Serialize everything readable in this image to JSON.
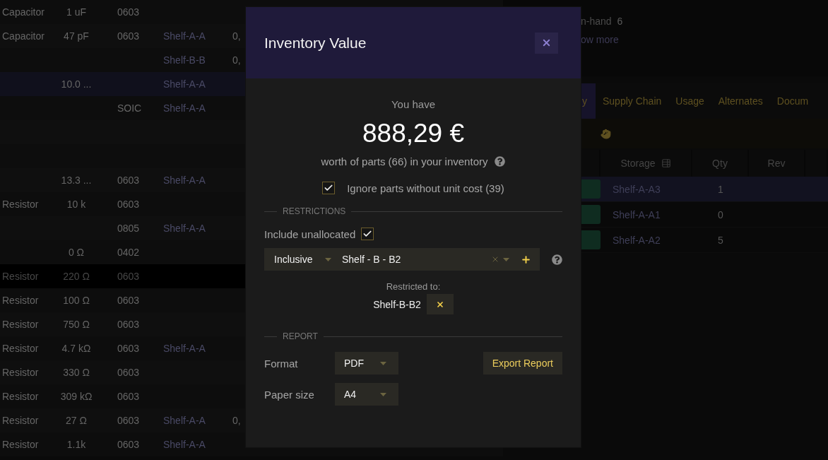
{
  "parts_table": {
    "rows": [
      {
        "column_1": "Capacitor",
        "column_2": "1 uF",
        "column_3": "0603",
        "selected": false,
        "disabled": false
      },
      {
        "column_1": "Capacitor",
        "column_2": "47 pF",
        "column_3": "0603",
        "column_4": "Shelf-A-A",
        "column_5": "0,",
        "selected": false,
        "disabled": false
      },
      {
        "column_4": "Shelf-B-B",
        "column_5": "0,",
        "selected": false,
        "disabled": false
      },
      {
        "column_2": "10.0 ...",
        "column_4": "Shelf-A-A",
        "selected": true,
        "disabled": false
      },
      {
        "column_3": "SOIC",
        "column_4": "Shelf-A-A",
        "selected": false,
        "disabled": false
      },
      {
        "selected": false,
        "disabled": false
      },
      {
        "selected": false,
        "disabled": false
      },
      {
        "column_2": "13.3 ...",
        "column_3": "0603",
        "column_4": "Shelf-A-A",
        "selected": false,
        "disabled": false
      },
      {
        "column_1": "Resistor",
        "column_2": "10 k",
        "column_3": "0603",
        "selected": false,
        "disabled": false
      },
      {
        "column_3": "0805",
        "column_4": "Shelf-A-A",
        "selected": false,
        "disabled": false
      },
      {
        "column_2": "0 Ω",
        "column_3": "0402",
        "selected": false,
        "disabled": false
      },
      {
        "column_1": "Resistor",
        "column_2": "220 Ω",
        "column_3": "0603",
        "selected": false,
        "disabled": true
      },
      {
        "column_1": "Resistor",
        "column_2": "100 Ω",
        "column_3": "0603",
        "selected": false,
        "disabled": false
      },
      {
        "column_1": "Resistor",
        "column_2": "750 Ω",
        "column_3": "0603",
        "selected": false,
        "disabled": false
      },
      {
        "column_1": "Resistor",
        "column_2": "4.7 kΩ",
        "column_3": "0603",
        "column_4": "Shelf-A-A",
        "selected": false,
        "disabled": false
      },
      {
        "column_1": "Resistor",
        "column_2": "330 Ω",
        "column_3": "0603",
        "selected": false,
        "disabled": false
      },
      {
        "column_1": "Resistor",
        "column_2": "309 kΩ",
        "column_3": "0603",
        "selected": false,
        "disabled": false
      },
      {
        "column_1": "Resistor",
        "column_2": "27 Ω",
        "column_3": "0603",
        "column_4": "Shelf-A-A",
        "column_5": "0,",
        "selected": false,
        "disabled": false
      },
      {
        "column_1": "Resistor",
        "column_2": "1.1k",
        "column_3": "0603",
        "column_4": "Shelf-A-A",
        "selected": false,
        "disabled": false
      }
    ]
  },
  "part_details": {
    "on_hand_label": "n-hand",
    "on_hand_value": "6",
    "show_more": "ow more"
  },
  "detail_tabs": [
    {
      "label": "y",
      "selected": true
    },
    {
      "label": "Supply Chain",
      "selected": false
    },
    {
      "label": "Usage",
      "selected": false
    },
    {
      "label": "Alternates",
      "selected": false
    },
    {
      "label": "Docum",
      "selected": false
    }
  ],
  "storage_table": {
    "columns": [
      "Storage",
      "Qty",
      "Rev"
    ],
    "rows": [
      {
        "storage": "Shelf-A-A3",
        "qty": "1",
        "selected": true
      },
      {
        "storage": "Shelf-A-A1",
        "qty": "0",
        "selected": false
      },
      {
        "storage": "Shelf-A-A2",
        "qty": "5",
        "selected": false
      }
    ]
  },
  "dialog": {
    "title": "Inventory Value",
    "lead": "You have",
    "amount": "888,29 €",
    "caption": "worth of parts (66) in your inventory",
    "ignore_option": {
      "label": "Ignore parts without unit cost (39)",
      "checked": true
    },
    "restrictions": {
      "heading": "RESTRICTIONS",
      "include_unallocated": {
        "label": "Include unallocated",
        "checked": true
      },
      "mode": "Inclusive",
      "location": "Shelf - B - B2",
      "restricted_label": "Restricted to:",
      "restricted_items": [
        "Shelf-B-B2"
      ]
    },
    "report": {
      "heading": "REPORT",
      "format_label": "Format",
      "format": "PDF",
      "paper_label": "Paper size",
      "paper": "A4",
      "export_button": "Export Report"
    }
  }
}
